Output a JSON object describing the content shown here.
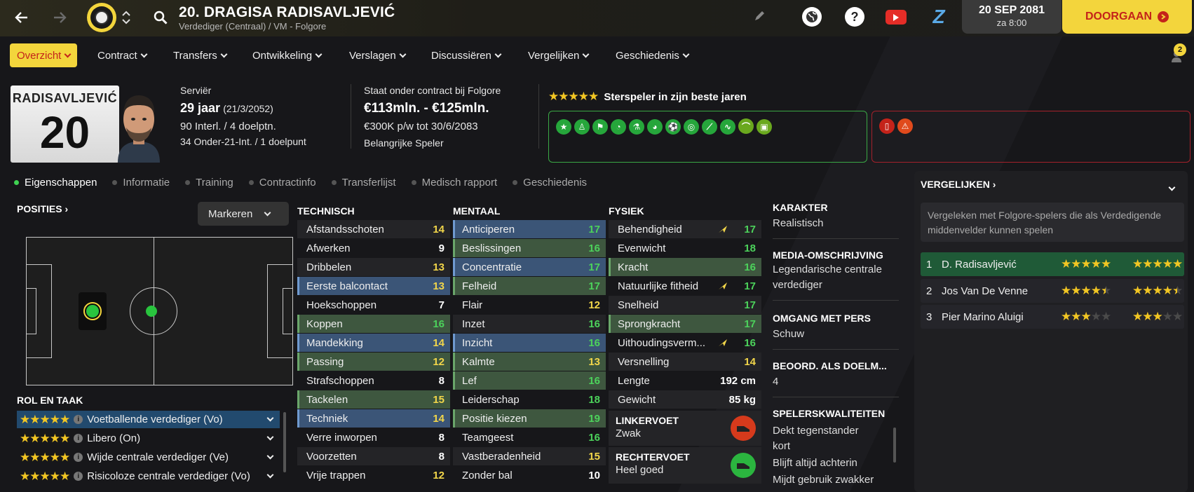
{
  "header": {
    "player_title": "20. DRAGISA RADISAVLJEVIĆ",
    "subtitle": "Verdediger (Centraal) / VM - Folgore",
    "date": "20 SEP 2081",
    "time": "za 8:00",
    "continue_label": "DOORGAAN",
    "notification_count": "2"
  },
  "nav": [
    {
      "label": "Overzicht"
    },
    {
      "label": "Contract"
    },
    {
      "label": "Transfers"
    },
    {
      "label": "Ontwikkeling"
    },
    {
      "label": "Verslagen"
    },
    {
      "label": "Discussiëren"
    },
    {
      "label": "Vergelijken"
    },
    {
      "label": "Geschiedenis"
    }
  ],
  "player": {
    "shirt_name": "RADISAVLJEVIĆ",
    "shirt_number": "20",
    "nationality": "Serviër",
    "age": "29 jaar",
    "dob": "(21/3/2052)",
    "intl": "90 Interl. / 4 doelptn.",
    "u21": "34 Onder-21-Int. / 1 doelpunt",
    "contract_club": "Staat onder contract bij Folgore",
    "value": "€113mln. - €125mln.",
    "wage": "€300K p/w tot 30/6/2083",
    "status": "Belangrijke Speler",
    "rating_text": "Sterspeler in zijn beste jaren"
  },
  "tabs": [
    "Eigenschappen",
    "Informatie",
    "Training",
    "Contractinfo",
    "Transferlijst",
    "Medisch rapport",
    "Geschiedenis"
  ],
  "positions": {
    "header": "POSITIES",
    "mark_label": "Markeren"
  },
  "roles": {
    "header": "ROL EN TAAK",
    "items": [
      {
        "label": "Voetballende verdediger (Vo)",
        "stars": 5
      },
      {
        "label": "Libero (On)",
        "stars": 5
      },
      {
        "label": "Wijde centrale verdediger (Ve)",
        "stars": 5
      },
      {
        "label": "Risicoloze centrale verdediger (Vo)",
        "stars": 5
      }
    ]
  },
  "technisch": {
    "header": "TECHNISCH",
    "rows": [
      {
        "label": "Afstandsschoten",
        "value": "14",
        "hl": "dark",
        "c": "y"
      },
      {
        "label": "Afwerken",
        "value": "9",
        "hl": "",
        "c": "w"
      },
      {
        "label": "Dribbelen",
        "value": "13",
        "hl": "dark",
        "c": "y"
      },
      {
        "label": "Eerste balcontact",
        "value": "13",
        "hl": "blue",
        "c": "y"
      },
      {
        "label": "Hoekschoppen",
        "value": "7",
        "hl": "",
        "c": "w"
      },
      {
        "label": "Koppen",
        "value": "16",
        "hl": "green",
        "c": "g"
      },
      {
        "label": "Mandekking",
        "value": "14",
        "hl": "blue",
        "c": "y"
      },
      {
        "label": "Passing",
        "value": "12",
        "hl": "green",
        "c": "y"
      },
      {
        "label": "Strafschoppen",
        "value": "8",
        "hl": "",
        "c": "w"
      },
      {
        "label": "Tackelen",
        "value": "15",
        "hl": "green",
        "c": "y"
      },
      {
        "label": "Techniek",
        "value": "14",
        "hl": "blue",
        "c": "y"
      },
      {
        "label": "Verre inworpen",
        "value": "8",
        "hl": "",
        "c": "w"
      },
      {
        "label": "Voorzetten",
        "value": "8",
        "hl": "dark",
        "c": "w"
      },
      {
        "label": "Vrije trappen",
        "value": "12",
        "hl": "",
        "c": "y"
      }
    ]
  },
  "mentaal": {
    "header": "MENTAAL",
    "rows": [
      {
        "label": "Anticiperen",
        "value": "17",
        "hl": "blue",
        "c": "g"
      },
      {
        "label": "Beslissingen",
        "value": "16",
        "hl": "green",
        "c": "g"
      },
      {
        "label": "Concentratie",
        "value": "17",
        "hl": "blue",
        "c": "g"
      },
      {
        "label": "Felheid",
        "value": "17",
        "hl": "green",
        "c": "g"
      },
      {
        "label": "Flair",
        "value": "12",
        "hl": "",
        "c": "y"
      },
      {
        "label": "Inzet",
        "value": "16",
        "hl": "dark",
        "c": "g"
      },
      {
        "label": "Inzicht",
        "value": "16",
        "hl": "blue",
        "c": "g"
      },
      {
        "label": "Kalmte",
        "value": "13",
        "hl": "green",
        "c": "y"
      },
      {
        "label": "Lef",
        "value": "16",
        "hl": "green",
        "c": "g"
      },
      {
        "label": "Leiderschap",
        "value": "18",
        "hl": "",
        "c": "g"
      },
      {
        "label": "Positie kiezen",
        "value": "19",
        "hl": "green",
        "c": "g"
      },
      {
        "label": "Teamgeest",
        "value": "16",
        "hl": "",
        "c": "g"
      },
      {
        "label": "Vastberadenheid",
        "value": "15",
        "hl": "dark",
        "c": "y"
      },
      {
        "label": "Zonder bal",
        "value": "10",
        "hl": "",
        "c": "w"
      }
    ]
  },
  "fysiek": {
    "header": "FYSIEK",
    "rows": [
      {
        "label": "Behendigheid",
        "value": "17",
        "hl": "dark",
        "c": "g",
        "arrow": true
      },
      {
        "label": "Evenwicht",
        "value": "18",
        "hl": "",
        "c": "g",
        "arrow": false
      },
      {
        "label": "Kracht",
        "value": "16",
        "hl": "green",
        "c": "g",
        "arrow": false
      },
      {
        "label": "Natuurlijke fitheid",
        "value": "17",
        "hl": "",
        "c": "g",
        "arrow": true
      },
      {
        "label": "Snelheid",
        "value": "17",
        "hl": "dark",
        "c": "g",
        "arrow": false
      },
      {
        "label": "Sprongkracht",
        "value": "17",
        "hl": "green",
        "c": "g",
        "arrow": false
      },
      {
        "label": "Uithoudingsverm...",
        "value": "16",
        "hl": "",
        "c": "g",
        "arrow": true
      },
      {
        "label": "Versnelling",
        "value": "14",
        "hl": "dark",
        "c": "y",
        "arrow": false
      },
      {
        "label": "Lengte",
        "value": "192 cm",
        "hl": "",
        "c": "w",
        "arrow": false
      },
      {
        "label": "Gewicht",
        "value": "85 kg",
        "hl": "dark",
        "c": "w",
        "arrow": false
      }
    ],
    "left_foot_label": "LINKERVOET",
    "left_foot_value": "Zwak",
    "right_foot_label": "RECHTERVOET",
    "right_foot_value": "Heel goed"
  },
  "karakter": {
    "h1": "KARAKTER",
    "v1": "Realistisch",
    "h2": "MEDIA-OMSCHRIJVING",
    "v2": "Legendarische centrale verdediger",
    "h3": "OMGANG MET PERS",
    "v3": "Schuw",
    "h4": "BEOORD. ALS DOELM...",
    "v4": "4",
    "h5": "SPELERSKWALITEITEN",
    "v5": "Dekt tegenstander kort",
    "v6": "Blijft altijd achterin",
    "v7": "Mijdt gebruik zwakker"
  },
  "compare": {
    "header": "VERGELIJKEN",
    "note": "Vergeleken met Folgore-spelers die als Verdedigende middenvelder kunnen spelen",
    "rows": [
      {
        "rank": "1",
        "name": "D. Radisavljević",
        "ca": 5,
        "pa": 5
      },
      {
        "rank": "2",
        "name": "Jos Van De Venne",
        "ca": 4.5,
        "pa": 4.5
      },
      {
        "rank": "3",
        "name": "Pier Marino Aluigi",
        "ca": 3,
        "pa": 3
      }
    ]
  },
  "colors": {
    "accent": "#f3d53c",
    "brand_red": "#c4231a",
    "good": "#4cd25b",
    "mid": "#f2d64a"
  }
}
